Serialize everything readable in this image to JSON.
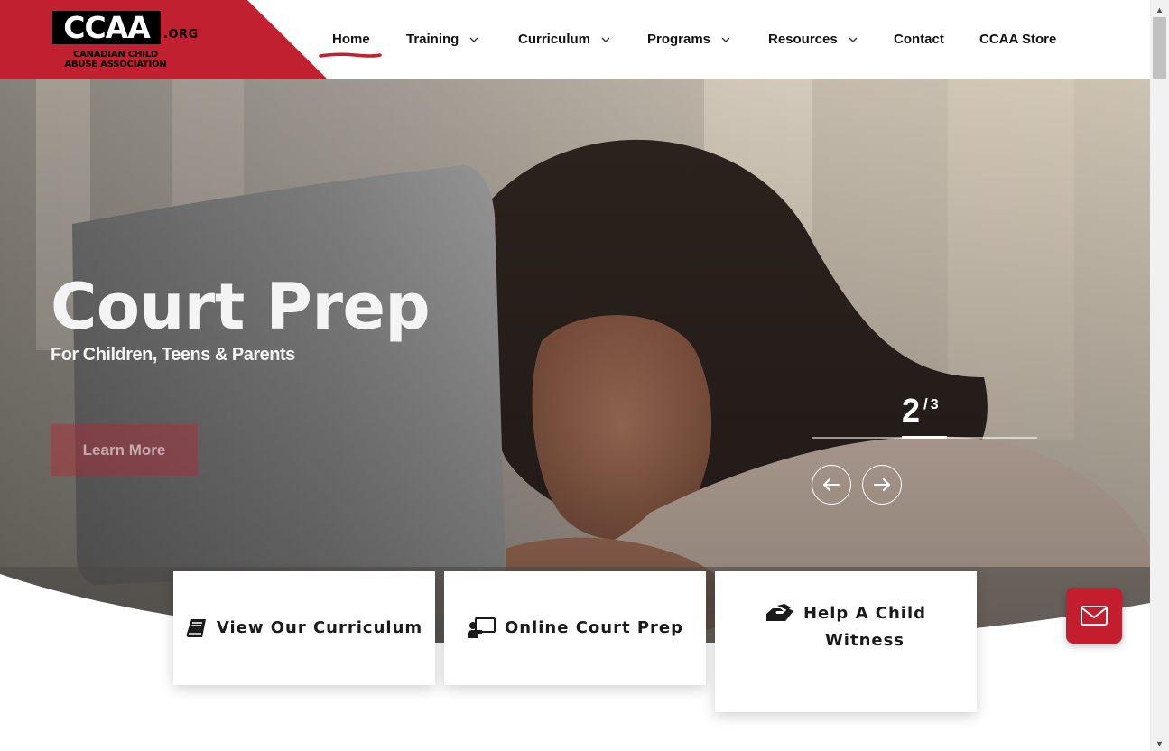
{
  "logo": {
    "main": "CCAA",
    "suffix": ".ORG",
    "line1": "CANADIAN CHILD",
    "line2": "ABUSE ASSOCIATION"
  },
  "nav": {
    "items": [
      {
        "label": "Home",
        "active": true,
        "dropdown": false
      },
      {
        "label": "Training",
        "dropdown": true
      },
      {
        "label": "Curriculum",
        "dropdown": true
      },
      {
        "label": "Programs",
        "dropdown": true
      },
      {
        "label": "Resources",
        "dropdown": true
      },
      {
        "label": "Contact",
        "dropdown": false
      },
      {
        "label": "CCAA Store",
        "dropdown": false
      }
    ]
  },
  "hero": {
    "title": "Court Prep",
    "subtitle": "For Children, Teens & Parents",
    "cta_label": "Learn More",
    "slide_current": "2",
    "slide_separator": "/",
    "slide_total": "3"
  },
  "cards": [
    {
      "label": "View Our Curriculum",
      "icon": "book-icon"
    },
    {
      "label": "Online Court Prep",
      "icon": "teacher-screen-icon"
    },
    {
      "label_line1": "Help A Child",
      "label_line2": "Witness",
      "icon": "hands-helping-icon"
    }
  ],
  "colors": {
    "brand_red": "#c0202f",
    "text_dark": "#111111",
    "white": "#ffffff"
  }
}
